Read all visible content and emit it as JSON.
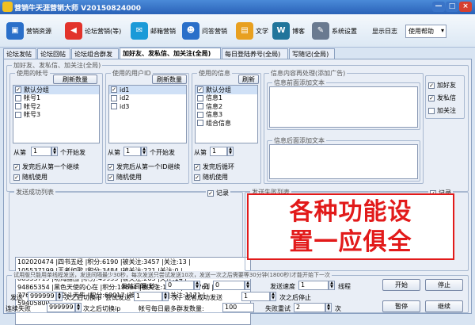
{
  "window": {
    "title": "营销牛天涯营销大师 V20150824000",
    "buttons": [
      "—",
      "□",
      "×"
    ]
  },
  "toolbar": {
    "items": [
      {
        "label": "营销资源",
        "icon": "dropbox-icon",
        "color": "#2a6fc9"
      },
      {
        "label": "论坛营销(等)",
        "icon": "megaphone-icon",
        "color": "#e2332b"
      },
      {
        "label": "邮箱营销",
        "icon": "mail-icon",
        "color": "#1a9ad8"
      },
      {
        "label": "问答营销",
        "icon": "users-icon",
        "color": "#2a6fc9"
      },
      {
        "label": "文学",
        "icon": "book-icon",
        "color": "#e8a020"
      },
      {
        "label": "博客",
        "icon": "wordpress-icon",
        "color": "#21759b"
      },
      {
        "label": "系统设置",
        "icon": "wrench-icon",
        "color": "#6a7a90"
      },
      {
        "label": "显示日志"
      }
    ],
    "help_select": "使用帮助"
  },
  "tabs": [
    "论坛发帖",
    "论坛回帖",
    "论坛组合群发",
    "加好友、发私信、加关注(全局)",
    "每日登陆养号(全局)",
    "写随记(全局)"
  ],
  "active_tab": 3,
  "outer_group": "加好友、发私信、加关注(全局)",
  "accounts": {
    "label": "使用的帐号",
    "refresh": "刷新数量",
    "items": [
      {
        "text": "默认分组",
        "checked": true
      },
      {
        "text": "帐号1",
        "checked": false
      },
      {
        "text": "帐号2",
        "checked": false
      },
      {
        "text": "帐号3",
        "checked": false
      }
    ],
    "from_label": "从第",
    "from_value": "1",
    "suffix": "个开始发",
    "opt1": "发完后从第一个继续",
    "opt1_checked": true,
    "opt2": "随机使用",
    "opt2_checked": true
  },
  "user_ids": {
    "label": "使用的用户ID",
    "refresh": "刷新数量",
    "items": [
      {
        "text": "id1",
        "checked": true
      },
      {
        "text": "id2",
        "checked": false
      },
      {
        "text": "id3",
        "checked": false
      }
    ],
    "from_label": "从第",
    "from_value": "1",
    "suffix": "个开始发",
    "opt1": "发完后从第一个ID继续",
    "opt1_checked": true,
    "opt2": "随机使用",
    "opt2_checked": true
  },
  "messages": {
    "label": "使用的信息",
    "refresh": "刷新",
    "items": [
      {
        "text": "默认分组",
        "checked": true
      },
      {
        "text": "信息1",
        "checked": false
      },
      {
        "text": "信息2",
        "checked": false
      },
      {
        "text": "信息3",
        "checked": false
      },
      {
        "text": "组合信息",
        "checked": false
      }
    ],
    "from_label": "从第",
    "from_value": "1",
    "opt1": "发完后循环",
    "opt1_checked": true,
    "opt2": "随机使用",
    "opt2_checked": true
  },
  "content_proc": {
    "label": "信息内容再处理(添加广告)",
    "before": "信息前面添加文本",
    "after": "信息后面添加文本"
  },
  "actions": [
    {
      "text": "加好友",
      "checked": true
    },
    {
      "text": "发私信",
      "checked": true
    },
    {
      "text": "加关注",
      "checked": false
    }
  ],
  "success_list": {
    "label": "发送成功列表",
    "record": "记录",
    "record_checked": true,
    "lines": [
      "102020474 |四书五经 |积分:6190 |被关注:3457 |关注:13 |",
      "105537199 |王者如歌 |积分:3484 |被关注:221 |关注:0 |",
      "86353719 |功海醋围 |积分:49933 |被关注:263 |关注:14 |",
      "94865354 |黑色天使的心在 |积分:19694 |被关注:1310 |关注:761 |",
      "77632141 |天空斗天牛 |积分:69017 |被关注:1072 |关注:1171 |",
      "59405800"
    ]
  },
  "fail_list": {
    "label": "发送失败列表",
    "record": "记录",
    "record_checked": true
  },
  "watermark": {
    "line1": "各种功能设",
    "line2": "置一应俱全"
  },
  "bottom": {
    "note": "试用版只能用单线程发送，发送间隔最少30秒，每次发送只尝试发送10次，发送一次之后需要等30分钟(1800秒)才能开始下一次",
    "interval_label": "发帖间隔(秒)",
    "interval_from": "0",
    "to": "到",
    "interval_to": "0",
    "speed_label": "发送速度",
    "speed_value": "1",
    "threads": "线程",
    "send_label": "发送",
    "send_value": "999999",
    "switch_ip": "次之后切换ip",
    "try_label": "尝试发送",
    "try_value": "1",
    "stop_after": "次，或者成功发送",
    "stop_value": "1",
    "stop_suffix": "次之后停止",
    "fail_label": "连续失败",
    "fail_value": "999999",
    "fail_switch": "次之后切换ip",
    "daily_label": "帐号每日最多群发数量:",
    "daily_value": "100",
    "retry_label": "失败重试",
    "retry_value": "2",
    "retry_suffix": "次",
    "start": "开始",
    "stop": "停止",
    "pause": "暂停",
    "resume": "继续"
  }
}
